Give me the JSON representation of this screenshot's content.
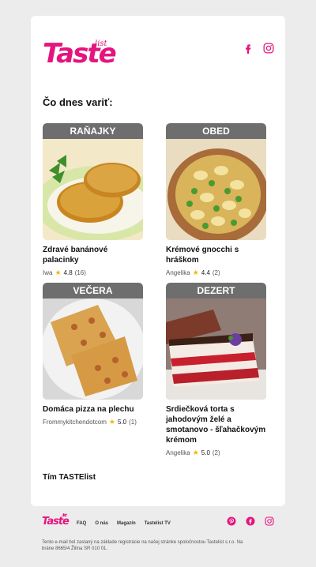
{
  "brand": {
    "logo_main": "Taste",
    "logo_sub": "list",
    "color": "#e4157e"
  },
  "social_top": [
    "facebook-icon",
    "instagram-icon"
  ],
  "heading": "Čo dnes variť:",
  "recipes": [
    {
      "category": "RAŇAJKY",
      "title": "Zdravé banánové palacinky",
      "author": "Iwa",
      "rating": "4.8",
      "count": "(16)"
    },
    {
      "category": "OBED",
      "title": "Krémové gnocchi s hráškom",
      "author": "Angelika",
      "rating": "4.4",
      "count": "(2)"
    },
    {
      "category": "VEČERA",
      "title": "Domáca pizza na plechu",
      "author": "Frommykitchendotcom",
      "rating": "5.0",
      "count": "(1)"
    },
    {
      "category": "DEZERT",
      "title": "Srdiečková torta s jahodovým želé a smotanovo - šľahačkovým krémom",
      "author": "Angelika",
      "rating": "5.0",
      "count": "(2)"
    }
  ],
  "signature": "Tím TASTElist",
  "footer": {
    "logo_main": "Taste",
    "logo_sub": "list",
    "links": [
      "FAQ",
      "O nás",
      "Magazín",
      "Tastelist TV"
    ],
    "social": [
      "pinterest-icon",
      "facebook-icon",
      "instagram-icon"
    ],
    "legal": "Tento e-mail bol zaslaný na základe registrácie na našej stránke spoločnostou Tastelist s.r.o. Na bráne 8665/4 Žilina SR 010 01."
  }
}
